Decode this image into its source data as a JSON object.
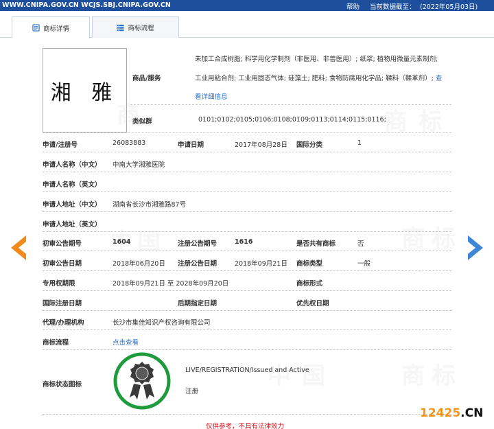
{
  "header": {
    "sites": "WWW.CNIPA.GOV.CN WCJS.SBJ.CNIPA.GOV.CN",
    "help": "帮助",
    "date_label": "当前数据截至：",
    "date_value": "(2022年05月03日)"
  },
  "tabs": [
    {
      "label": "商标详情",
      "icon": "document-icon",
      "active": true
    },
    {
      "label": "商标流程",
      "icon": "list-icon",
      "active": false
    }
  ],
  "mark": {
    "image_text": "湘 雅",
    "goods_label": "商品/服务",
    "goods_line1": "未加工合成树脂; 科学用化学制剂（非医用、非兽医用）; 纸浆; 植物用微量元素制剂;",
    "goods_line2": "工业用粘合剂; 工业用固态气体; 硅藻土; 肥料; 食物防腐用化学品; 鞣料（鞣革剂）; ",
    "goods_more_inline": "查",
    "goods_more": "看详细信息",
    "similar_label": "类似群",
    "similar_value": "0101;0102;0105;0106;0108;0109;0113;0114;0115;0116;"
  },
  "fields": {
    "reg_no_label": "申请/注册号",
    "reg_no": "26083883",
    "app_date_label": "申请日期",
    "app_date": "2017年08月28日",
    "intl_class_label": "国际分类",
    "intl_class": "1",
    "applicant_cn_label": "申请人名称（中文）",
    "applicant_cn": "中南大学湘雅医院",
    "applicant_en_label": "申请人名称（英文）",
    "applicant_en": "",
    "address_cn_label": "申请人地址（中文）",
    "address_cn": "湖南省长沙市湘雅路87号",
    "address_en_label": "申请人地址（英文）",
    "address_en": "",
    "prelim_no_label": "初审公告期号",
    "prelim_no": "1604",
    "reg_pub_no_label": "注册公告期号",
    "reg_pub_no": "1616",
    "shared_label": "是否共有商标",
    "shared": "否",
    "prelim_date_label": "初审公告日期",
    "prelim_date": "2018年06月20日",
    "reg_pub_date_label": "注册公告日期",
    "reg_pub_date": "2018年09月21日",
    "mark_type_label": "商标类型",
    "mark_type": "一般",
    "exclusive_label": "专用权期限",
    "exclusive": "2018年09月21日 至 2028年09月20日",
    "mark_form_label": "商标形式",
    "mark_form": "",
    "intl_reg_date_label": "国际注册日期",
    "intl_reg_date": "",
    "later_date_label": "后期指定日期",
    "later_date": "",
    "priority_label": "优先权日期",
    "priority": "",
    "agent_label": "代理/办理机构",
    "agent": "长沙市集佳知识产权咨询有限公司",
    "process_label": "商标流程",
    "process_link": "点击查看",
    "status_icon_label": "商标状态图标",
    "status_en": "LIVE/REGISTRATION/Issued and Active",
    "status_cn": "注册"
  },
  "footer": {
    "disclaimer": "仅供参考，不具有法律效力",
    "corner_num": "12425",
    "corner_domain": ".CN"
  },
  "colors": {
    "header_blue": "#1d4f9c",
    "link_blue": "#2a6fc9",
    "nav_left_orange": "#f08a1c",
    "nav_right_blue": "#3f86d6",
    "badge_green": "#1f9a3c",
    "disclaimer_red": "#d9161c"
  },
  "icons": [
    "document-icon",
    "list-icon",
    "prev-arrow-icon",
    "next-arrow-icon",
    "registered-seal-icon"
  ]
}
